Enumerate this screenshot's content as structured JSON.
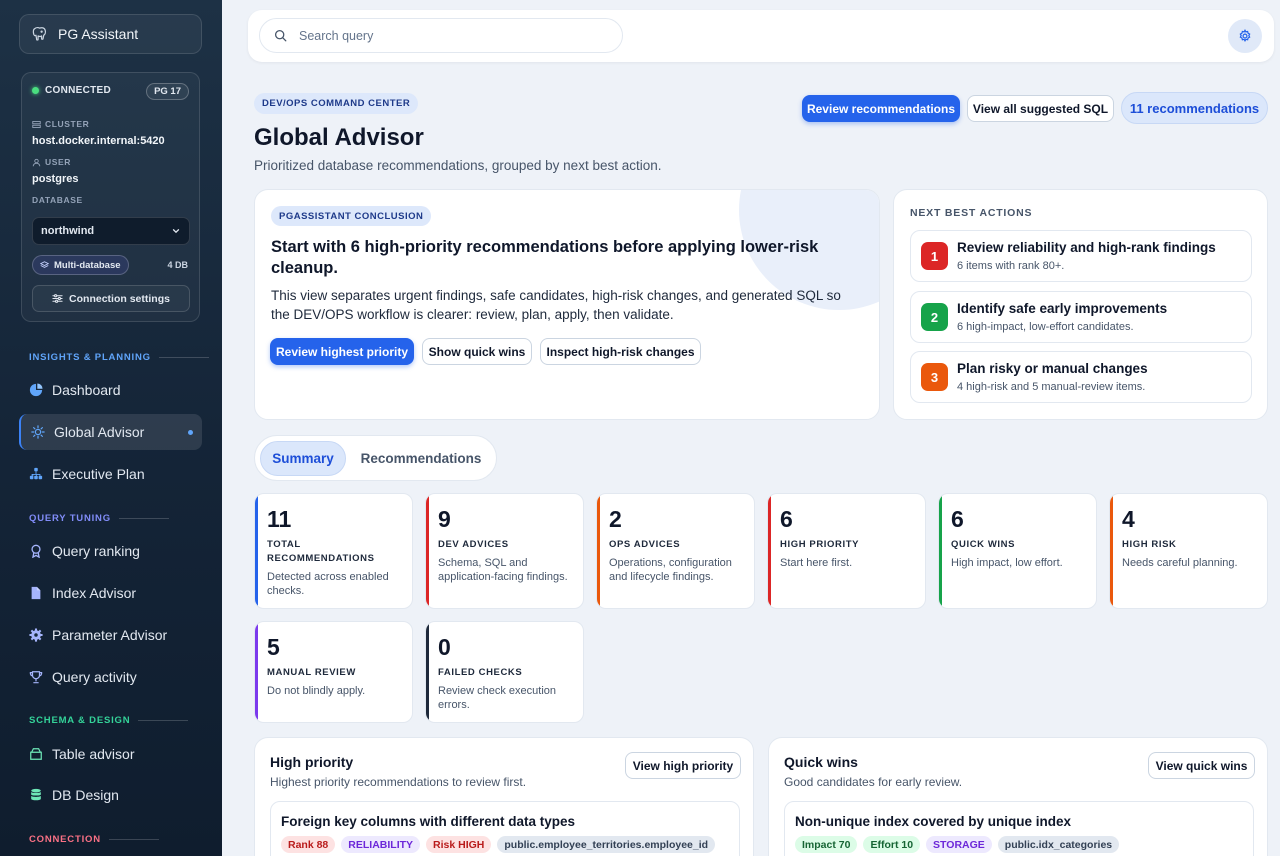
{
  "sidebar": {
    "brand": "PG Assistant",
    "connection": {
      "status": "CONNECTED",
      "version": "PG 17",
      "cluster_label": "CLUSTER",
      "cluster": "host.docker.internal:5420",
      "user_label": "USER",
      "user": "postgres",
      "database_label": "DATABASE",
      "database": "northwind",
      "multi_label": "Multi-database",
      "db_count": "4 DB",
      "settings_label": "Connection settings"
    },
    "sections": [
      {
        "title": "INSIGHTS & PLANNING",
        "color": "#60a5fa"
      },
      {
        "title": "QUERY TUNING",
        "color": "#818cf8"
      },
      {
        "title": "SCHEMA & DESIGN",
        "color": "#34d399"
      },
      {
        "title": "CONNECTION",
        "color": "#fb7185"
      }
    ],
    "items": [
      {
        "label": "Dashboard",
        "icon": "pie-chart-icon"
      },
      {
        "label": "Global Advisor",
        "icon": "sun-icon",
        "active": true
      },
      {
        "label": "Executive Plan",
        "icon": "hierarchy-icon"
      },
      {
        "label": "Query ranking",
        "icon": "badge-icon"
      },
      {
        "label": "Index Advisor",
        "icon": "file-icon"
      },
      {
        "label": "Parameter Advisor",
        "icon": "cog-icon"
      },
      {
        "label": "Query activity",
        "icon": "trophy-icon"
      },
      {
        "label": "Table advisor",
        "icon": "archive-icon"
      },
      {
        "label": "DB Design",
        "icon": "database-icon"
      }
    ]
  },
  "topbar": {
    "search_placeholder": "Search query",
    "settings_icon": "gear-icon"
  },
  "header": {
    "eyebrow": "DEV/OPS COMMAND CENTER",
    "title": "Global Advisor",
    "subtitle": "Prioritized database recommendations, grouped by next best action.",
    "review_button": "Review recommendations",
    "view_sql_button": "View all suggested SQL",
    "reco_count": "11 recommendations"
  },
  "conclusion": {
    "eyebrow": "PGASSISTANT CONCLUSION",
    "title": "Start with 6 high-priority recommendations before applying lower-risk cleanup.",
    "body": "This view separates urgent findings, safe candidates, high-risk changes, and generated SQL so the DEV/OPS workflow is clearer: review, plan, apply, then validate.",
    "buttons": [
      "Review highest priority",
      "Show quick wins",
      "Inspect high-risk changes"
    ]
  },
  "next_actions": {
    "title": "NEXT BEST ACTIONS",
    "items": [
      {
        "num": "1",
        "title": "Review reliability and high-rank findings",
        "sub": "6 items with rank 80+.",
        "color": "#dc2626"
      },
      {
        "num": "2",
        "title": "Identify safe early improvements",
        "sub": "6 high-impact, low-effort candidates.",
        "color": "#16a34a"
      },
      {
        "num": "3",
        "title": "Plan risky or manual changes",
        "sub": "4 high-risk and 5 manual-review items.",
        "color": "#ea580c"
      }
    ]
  },
  "tabs": [
    "Summary",
    "Recommendations"
  ],
  "stats": [
    {
      "value": "11",
      "label": "TOTAL RECOMMENDATIONS",
      "desc": "Detected across enabled checks.",
      "color": "#2563eb"
    },
    {
      "value": "9",
      "label": "DEV ADVICES",
      "desc": "Schema, SQL and application-facing findings.",
      "color": "#dc2626"
    },
    {
      "value": "2",
      "label": "OPS ADVICES",
      "desc": "Operations, configuration and lifecycle findings.",
      "color": "#ea580c"
    },
    {
      "value": "6",
      "label": "HIGH PRIORITY",
      "desc": "Start here first.",
      "color": "#dc2626"
    },
    {
      "value": "6",
      "label": "QUICK WINS",
      "desc": "High impact, low effort.",
      "color": "#16a34a"
    },
    {
      "value": "4",
      "label": "HIGH RISK",
      "desc": "Needs careful planning.",
      "color": "#ea580c"
    },
    {
      "value": "5",
      "label": "MANUAL REVIEW",
      "desc": "Do not blindly apply.",
      "color": "#7c3aed"
    },
    {
      "value": "0",
      "label": "FAILED CHECKS",
      "desc": "Review check execution errors.",
      "color": "#1e293b"
    }
  ],
  "panels": [
    {
      "title": "High priority",
      "sub": "Highest priority recommendations to review first.",
      "button": "View high priority",
      "item_title": "Foreign key columns with different data types",
      "chips": [
        {
          "text": "Rank 88",
          "bg": "#fde2e2",
          "fg": "#b91c1c"
        },
        {
          "text": "RELIABILITY",
          "bg": "#ede9fe",
          "fg": "#6d28d9"
        },
        {
          "text": "Risk HIGH",
          "bg": "#fde2e2",
          "fg": "#b91c1c"
        },
        {
          "text": "public.employee_territories.employee_id",
          "bg": "#e2e8f0",
          "fg": "#334155"
        }
      ]
    },
    {
      "title": "Quick wins",
      "sub": "Good candidates for early review.",
      "button": "View quick wins",
      "item_title": "Non-unique index covered by unique index",
      "chips": [
        {
          "text": "Impact 70",
          "bg": "#dcfce7",
          "fg": "#166534"
        },
        {
          "text": "Effort 10",
          "bg": "#dcfce7",
          "fg": "#166534"
        },
        {
          "text": "STORAGE",
          "bg": "#ede9fe",
          "fg": "#6d28d9"
        },
        {
          "text": "public.idx_categories",
          "bg": "#e2e8f0",
          "fg": "#334155"
        }
      ]
    }
  ]
}
